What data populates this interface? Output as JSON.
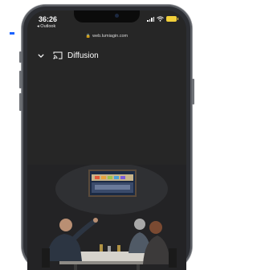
{
  "status": {
    "time": "36:26",
    "back_app": "◂ Outlook",
    "battery_color": "#f1cf3a"
  },
  "browser": {
    "url": "web.lumiagin.com"
  },
  "page": {
    "title": "Diffusion"
  },
  "icons": {
    "collapse": "chevron-down-icon",
    "cast": "cast-icon",
    "lock": "lock-icon",
    "wifi": "wifi-icon"
  },
  "colors": {
    "accent": "#1a62ff",
    "screen_bg": "#262626"
  }
}
